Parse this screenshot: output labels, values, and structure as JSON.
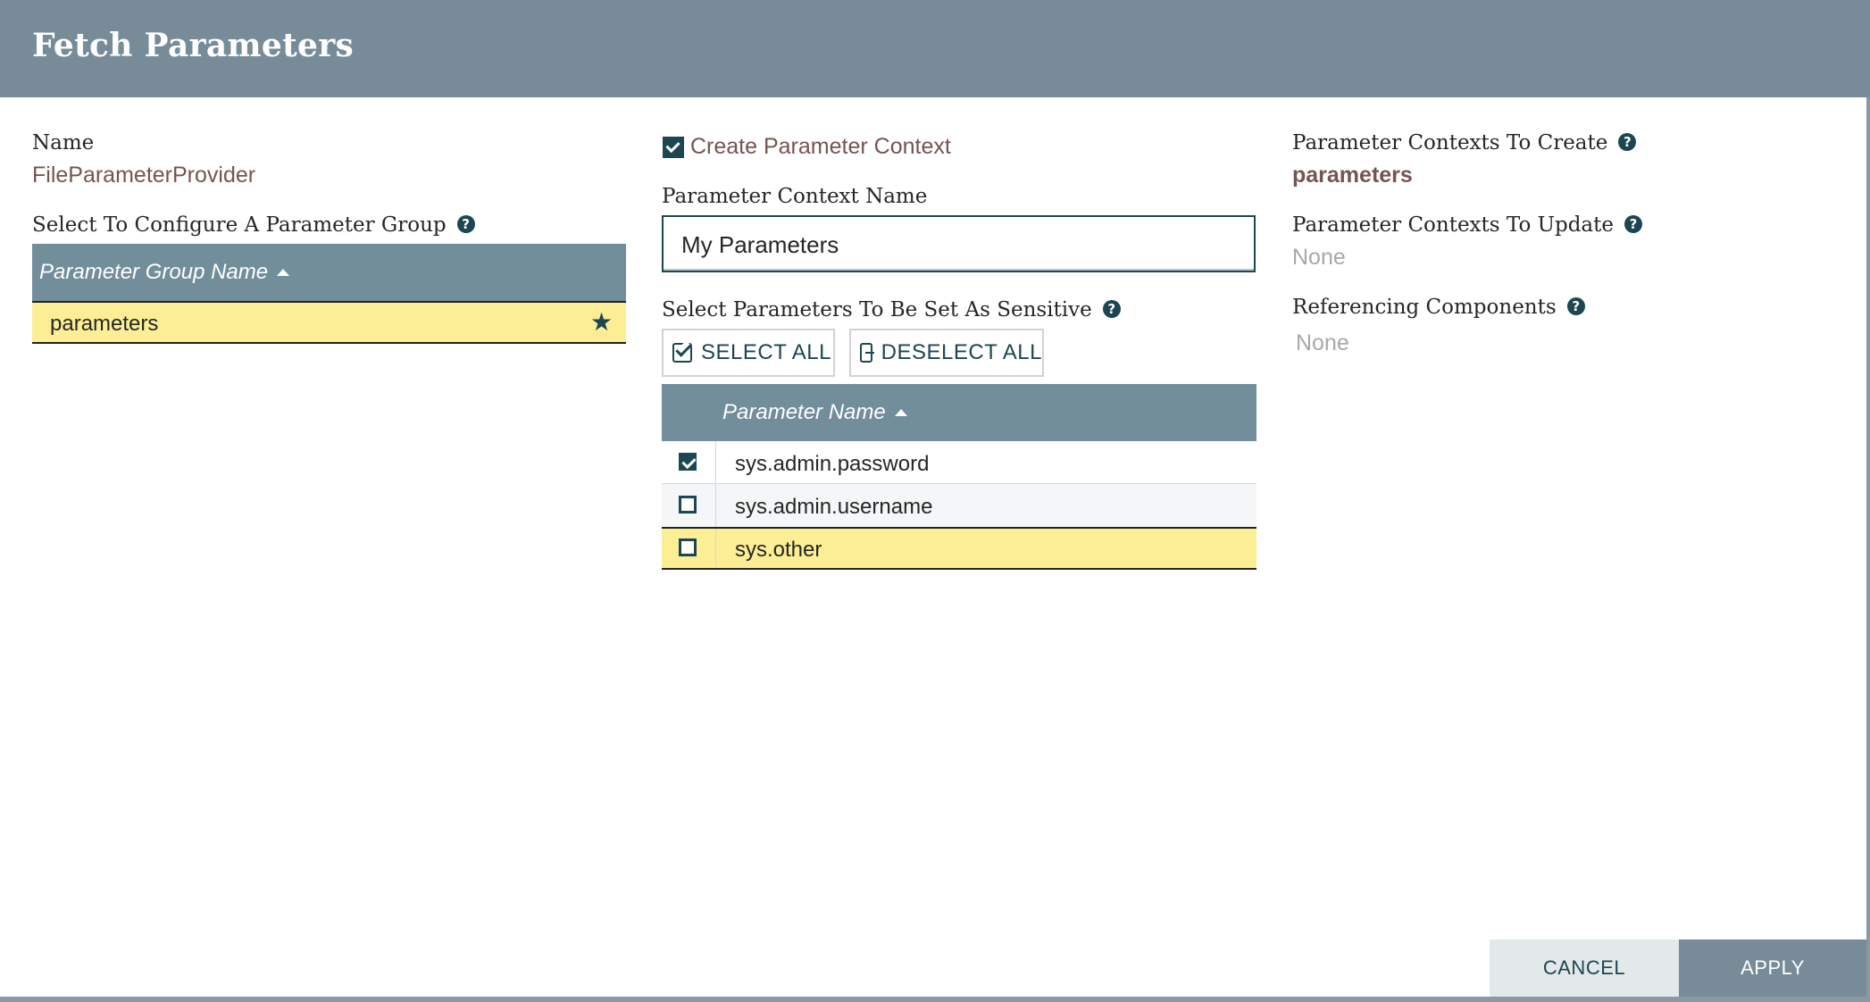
{
  "dialog": {
    "title": "Fetch Parameters"
  },
  "left": {
    "name_label": "Name",
    "name_value": "FileParameterProvider",
    "group_label": "Select To Configure A Parameter Group",
    "group_header": "Parameter Group Name",
    "groups": [
      {
        "name": "parameters",
        "selected": true,
        "starred": true
      }
    ]
  },
  "middle": {
    "create_context_label": "Create Parameter Context",
    "create_context_checked": true,
    "context_name_label": "Parameter Context Name",
    "context_name_value": "My Parameters",
    "sensitive_label": "Select Parameters To Be Set As Sensitive",
    "select_all_label": "SELECT ALL",
    "deselect_all_label": "DESELECT ALL",
    "param_header": "Parameter Name",
    "params": [
      {
        "name": "sys.admin.password",
        "checked": true,
        "selected": false
      },
      {
        "name": "sys.admin.username",
        "checked": false,
        "selected": false
      },
      {
        "name": "sys.other",
        "checked": false,
        "selected": true
      }
    ]
  },
  "right": {
    "to_create_label": "Parameter Contexts To Create",
    "to_create_value": "parameters",
    "to_update_label": "Parameter Contexts To Update",
    "to_update_value": "None",
    "referencing_label": "Referencing Components",
    "referencing_value": "None"
  },
  "footer": {
    "cancel_label": "CANCEL",
    "apply_label": "APPLY"
  },
  "colors": {
    "header_bg": "#778c98",
    "accent_dark": "#1c4651",
    "value_brown": "#775351",
    "selected_row": "#fbee95",
    "apply_bg": "#778c98",
    "cancel_bg": "#e3e8eb"
  },
  "icons": [
    "help-icon",
    "sort-ascending-icon",
    "star-icon",
    "checkbox-icon",
    "select-all-icon",
    "deselect-all-icon"
  ]
}
